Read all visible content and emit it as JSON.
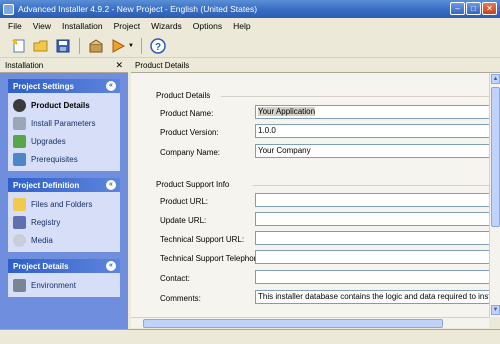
{
  "window": {
    "title": "Advanced Installer 4.9.2 - New Project - English (United States)"
  },
  "menu": [
    "File",
    "View",
    "Installation",
    "Project",
    "Wizards",
    "Options",
    "Help"
  ],
  "left_pane": {
    "header": "Installation",
    "groups": [
      {
        "title": "Project Settings",
        "items": [
          "Product Details",
          "Install Parameters",
          "Upgrades",
          "Prerequisites"
        ],
        "active": "Product Details"
      },
      {
        "title": "Project Definition",
        "items": [
          "Files and Folders",
          "Registry",
          "Media"
        ]
      },
      {
        "title": "Project Details",
        "items": [
          "Environment"
        ]
      }
    ]
  },
  "main": {
    "header": "Product Details",
    "product_details": {
      "section_title": "Product Details",
      "fields": [
        {
          "label": "Product Name:",
          "value": "Your Application"
        },
        {
          "label": "Product Version:",
          "value": "1.0.0"
        },
        {
          "label": "Company Name:",
          "value": "Your Company"
        }
      ]
    },
    "support_info": {
      "section_title": "Product Support Info",
      "fields": [
        {
          "label": "Product URL:",
          "value": ""
        },
        {
          "label": "Update URL:",
          "value": ""
        },
        {
          "label": "Technical Support URL:",
          "value": ""
        },
        {
          "label": "Technical Support Telephone:",
          "value": ""
        },
        {
          "label": "Contact:",
          "value": ""
        },
        {
          "label": "Comments:",
          "value": "This installer database contains the logic and data required to install [|Pro"
        }
      ]
    }
  },
  "icons": {
    "toolbar": [
      "new-icon",
      "open-icon",
      "save-icon",
      "build-icon",
      "run-icon",
      "help-icon"
    ]
  }
}
